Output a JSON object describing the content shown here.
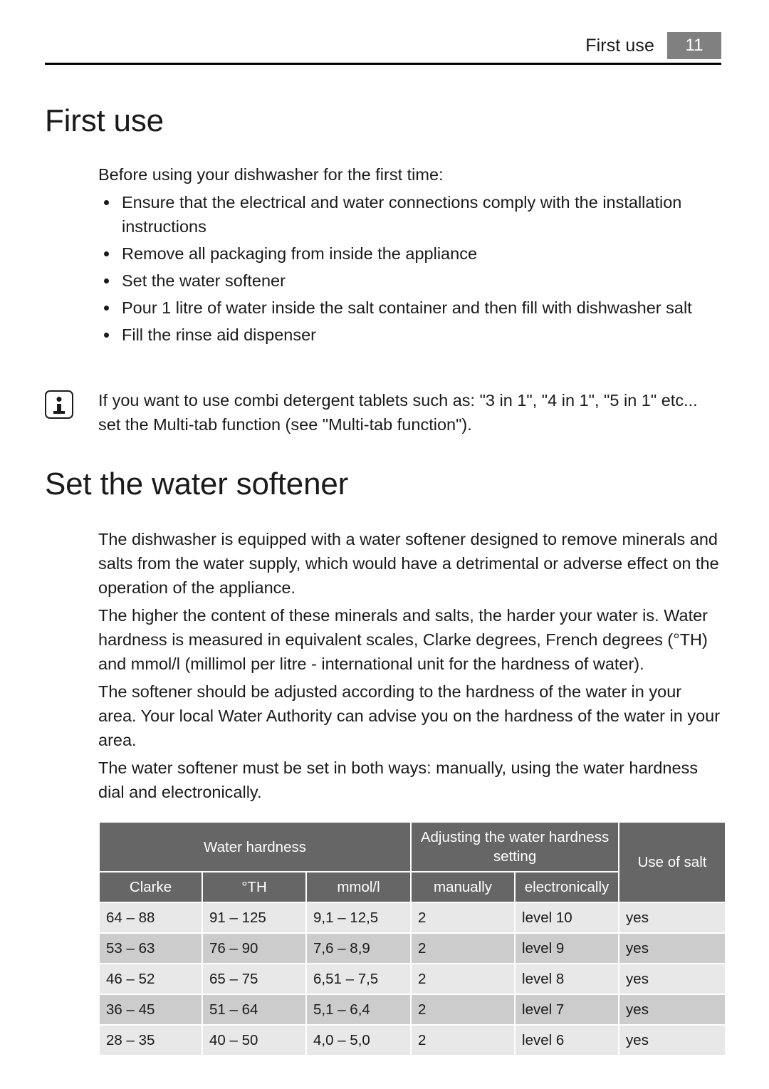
{
  "header": {
    "title": "First use",
    "page_number": "11"
  },
  "sections": {
    "first_use": {
      "heading": "First use",
      "intro": "Before using your dishwasher for the first time:",
      "bullets": [
        "Ensure that the electrical and water connections comply with the installation instructions",
        "Remove all packaging from inside the appliance",
        "Set the water softener",
        "Pour 1 litre of water inside the salt container and then fill with dishwasher salt",
        "Fill the rinse aid dispenser"
      ]
    },
    "note": {
      "icon": "info-icon",
      "text": "If you want to use combi detergent tablets such as: \"3 in 1\", \"4 in 1\", \"5 in 1\" etc... set the Multi-tab function (see \"Multi-tab function\")."
    },
    "water_softener": {
      "heading": "Set the water softener",
      "paragraphs": [
        "The dishwasher is equipped with a water softener designed to remove minerals and salts from the water supply, which would have a detrimental or adverse effect on the operation of the appliance.",
        "The higher the content of these minerals and salts, the harder your water is. Water hardness is measured in equivalent scales, Clarke degrees, French degrees (°TH) and mmol/l (millimol per litre - international unit for the hardness of water).",
        "The softener should be adjusted according to the hardness of the water in your area. Your local Water Authority can advise you on the hardness of the water in your area.",
        "The water softener must be set in both ways: manually, using the water hardness dial and electronically."
      ]
    }
  },
  "table": {
    "group_headers": {
      "water_hardness": "Water hardness",
      "adjusting": "Adjusting the water hardness setting",
      "use_of_salt": "Use of salt"
    },
    "sub_headers": {
      "clarke": "Clarke",
      "th": "°TH",
      "mmol": "mmol/l",
      "manually": "manually",
      "electronically": "electronically"
    },
    "rows": [
      {
        "clarke": "64 – 88",
        "th": "91 – 125",
        "mmol": "9,1 – 12,5",
        "manually": "2",
        "electronically": "level 10",
        "salt": "yes"
      },
      {
        "clarke": "53 – 63",
        "th": "76 – 90",
        "mmol": "7,6 – 8,9",
        "manually": "2",
        "electronically": "level 9",
        "salt": "yes"
      },
      {
        "clarke": "46 – 52",
        "th": "65 – 75",
        "mmol": "6,51 – 7,5",
        "manually": "2",
        "electronically": "level 8",
        "salt": "yes"
      },
      {
        "clarke": "36 – 45",
        "th": "51 – 64",
        "mmol": "5,1 – 6,4",
        "manually": "2",
        "electronically": "level 7",
        "salt": "yes"
      },
      {
        "clarke": "28 – 35",
        "th": "40 – 50",
        "mmol": "4,0 – 5,0",
        "manually": "2",
        "electronically": "level 6",
        "salt": "yes"
      }
    ]
  },
  "colors": {
    "table_header_gray": "#666666",
    "page_badge_gray": "#808080",
    "row_odd": "#e8e8e8",
    "row_even": "#cccccc",
    "text": "#1a1a1a"
  }
}
